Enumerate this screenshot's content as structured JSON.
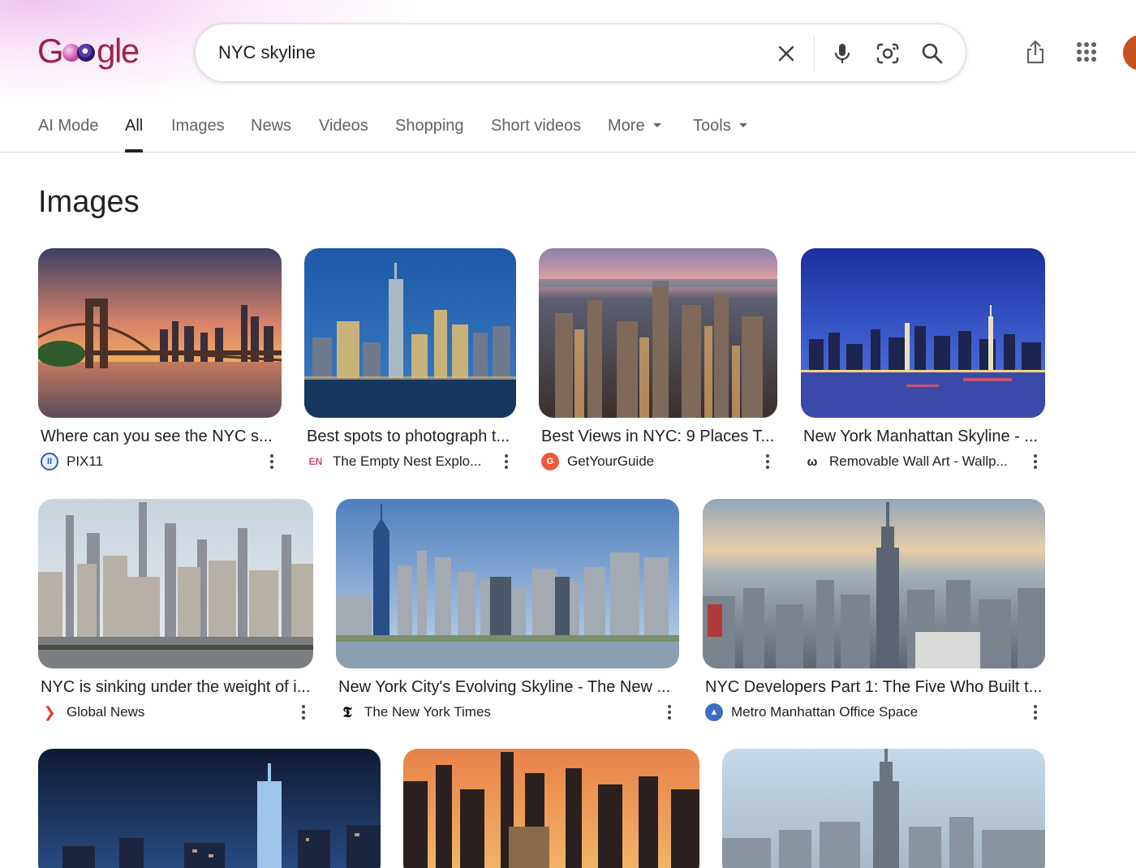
{
  "search": {
    "query": "NYC skyline",
    "placeholder": "Search"
  },
  "logo": {
    "text_g": "G",
    "text_rest": "gle"
  },
  "tabs": [
    {
      "label": "AI Mode"
    },
    {
      "label": "All"
    },
    {
      "label": "Images"
    },
    {
      "label": "News"
    },
    {
      "label": "Videos"
    },
    {
      "label": "Shopping"
    },
    {
      "label": "Short videos"
    },
    {
      "label": "More"
    },
    {
      "label": "Tools"
    }
  ],
  "section": {
    "title": "Images"
  },
  "cards": [
    {
      "title": "Where can you see the NYC s...",
      "source": "PIX11",
      "icon": "pix11-icon",
      "fav_color": "#2f5fb3",
      "fav_text": "II"
    },
    {
      "title": "Best spots to photograph t...",
      "source": "The Empty Nest Explo...",
      "icon": "empty-nest-icon",
      "fav_color": "#ffffff",
      "fav_text": "EN"
    },
    {
      "title": "Best Views in NYC: 9 Places T...",
      "source": "GetYourGuide",
      "icon": "getyourguide-icon",
      "fav_color": "#f05a3a",
      "fav_text": "G"
    },
    {
      "title": "New York Manhattan Skyline - ...",
      "source": "Removable Wall Art - Wallp...",
      "icon": "wall-art-icon",
      "fav_color": "#ffffff",
      "fav_text": "ω"
    },
    {
      "title": "NYC is sinking under the weight of i...",
      "source": "Global News",
      "icon": "global-news-icon",
      "fav_color": "#ffffff",
      "fav_text": "❯"
    },
    {
      "title": "New York City's Evolving Skyline - The New ...",
      "source": "The New York Times",
      "icon": "nyt-icon",
      "fav_color": "#ffffff",
      "fav_text": "𝕿"
    },
    {
      "title": "NYC Developers Part 1: The Five Who Built t...",
      "source": "Metro Manhattan Office Space",
      "icon": "metro-manhattan-icon",
      "fav_color": "#3b6fc4",
      "fav_text": "▲"
    },
    {
      "title": "",
      "source": "",
      "icon": "",
      "fav_color": "",
      "fav_text": ""
    },
    {
      "title": "",
      "source": "",
      "icon": "",
      "fav_color": "",
      "fav_text": ""
    },
    {
      "title": "",
      "source": "",
      "icon": "",
      "fav_color": "",
      "fav_text": ""
    }
  ],
  "colors": {
    "text": "#202124",
    "muted": "#5f6368",
    "border": "#dadce0",
    "avatar": "#c5521f",
    "logo": "#a0234f"
  }
}
